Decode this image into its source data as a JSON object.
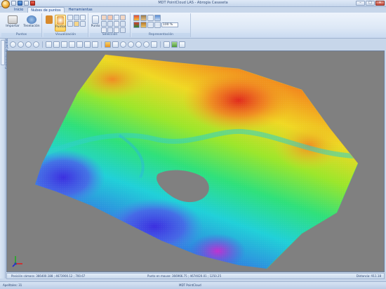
{
  "window": {
    "title": "MDT PointCloud LAS - Abrogia Casaseta",
    "controls": [
      "–",
      "□",
      "✕"
    ]
  },
  "tabs": [
    {
      "label": "Inicio",
      "active": false
    },
    {
      "label": "Nubes de puntos",
      "active": true
    },
    {
      "label": "Herramientas",
      "active": false
    }
  ],
  "ribbon": {
    "groups": {
      "puntos": {
        "label": "Puntos",
        "importar": "Importar",
        "rasterizar": "Teselación"
      },
      "visualizacion": {
        "label": "Visualización",
        "puntos_btn": "Puntos"
      },
      "seleccion": {
        "label": "Selección",
        "punto_btn": "Punto"
      },
      "representacion": {
        "label": "Representación",
        "percent": "100 %"
      }
    }
  },
  "sidepanel": {
    "tab_label": "Explorador de puntos"
  },
  "status": {
    "camera": "Posición cámara: 366400.188 ; 4673900.12 ; 700.67",
    "point": "Punto en mouse: 366966.75 ; 4674020.01 ; 1250.25",
    "distance": "Distancia: 911.18"
  },
  "bottom": {
    "left": "Apelltales: 31",
    "center": "MDT PointCloud"
  },
  "colors": {
    "viewport_bg": "#808080",
    "ribbon_bg": "#dde8f6",
    "accent": "#ffd25c"
  }
}
